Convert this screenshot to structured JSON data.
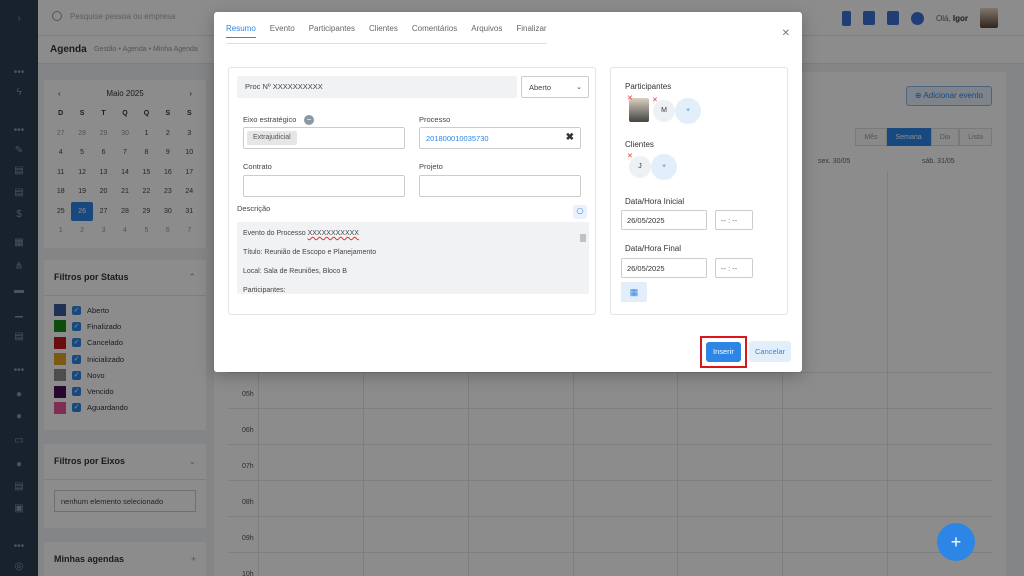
{
  "topbar": {
    "search_placeholder": "Pesquise pessoa ou empresa",
    "greeting_prefix": "Olá,",
    "user_name": "Igor"
  },
  "breadcrumb": {
    "title": "Agenda",
    "path": "Gestão • Agenda • Minha Agenda"
  },
  "calendar": {
    "month_label": "Maio 2025",
    "prev": "‹",
    "next": "›",
    "weekdays": [
      "D",
      "S",
      "T",
      "Q",
      "Q",
      "S",
      "S"
    ],
    "weeks": [
      [
        "27",
        "28",
        "29",
        "30",
        "1",
        "2",
        "3"
      ],
      [
        "4",
        "5",
        "6",
        "7",
        "8",
        "9",
        "10"
      ],
      [
        "11",
        "12",
        "13",
        "14",
        "15",
        "16",
        "17"
      ],
      [
        "18",
        "19",
        "20",
        "21",
        "22",
        "23",
        "24"
      ],
      [
        "25",
        "26",
        "27",
        "28",
        "29",
        "30",
        "31"
      ],
      [
        "1",
        "2",
        "3",
        "4",
        "5",
        "6",
        "7"
      ]
    ],
    "selected": "26"
  },
  "status_filters": {
    "title": "Filtros por Status",
    "items": [
      {
        "label": "Aberto",
        "color": "#3d5a99"
      },
      {
        "label": "Finalizado",
        "color": "#1a8a1a"
      },
      {
        "label": "Cancelado",
        "color": "#c0181e"
      },
      {
        "label": "Inicializado",
        "color": "#e0a22a"
      },
      {
        "label": "Novo",
        "color": "#8c8c8c"
      },
      {
        "label": "Vencido",
        "color": "#4a0d55"
      },
      {
        "label": "Aguardando",
        "color": "#e8549a"
      }
    ]
  },
  "eixo_filters": {
    "title": "Filtros por Eixos",
    "value": "nenhum elemento selecionado"
  },
  "my_agendas": {
    "title": "Minhas agendas",
    "add": "+"
  },
  "main": {
    "add_event_label": "Adicionar evento",
    "views": [
      "Mês",
      "Semana",
      "Dia",
      "Lista"
    ],
    "active_view": "Semana",
    "col_heads": [
      "sex. 30/05",
      "sáb. 31/05"
    ],
    "hours": [
      "05h",
      "06h",
      "07h",
      "08h",
      "09h",
      "10h"
    ]
  },
  "modal": {
    "tabs": [
      "Resumo",
      "Evento",
      "Participantes",
      "Clientes",
      "Comentários",
      "Arquivos",
      "Finalizar"
    ],
    "active_tab": "Resumo",
    "proc_title": "Proc Nº XXXXXXXXXX",
    "status_value": "Aberto",
    "eixo_label": "Eixo estratégico",
    "eixo_tag": "Extrajudicial",
    "processo_label": "Processo",
    "processo_value": "201800010035730",
    "contrato_label": "Contrato",
    "projeto_label": "Projeto",
    "descricao_label": "Descrição",
    "descricao_lines": {
      "l1_prefix": "Evento do Processo ",
      "l1_underlined": "XXXXXXXXXXX",
      "l2": "Título: Reunião de Escopo e Planejamento",
      "l3": "Local: Sala de Reuniões, Bloco B",
      "l4": "Participantes:"
    },
    "participantes_label": "Participantes",
    "participant_letter": "M",
    "clientes_label": "Clientes",
    "client_letter": "J",
    "add_symbol": "+",
    "data_inicial_label": "Data/Hora Inicial",
    "data_inicial_value": "26/05/2025",
    "data_final_label": "Data/Hora Final",
    "data_final_value": "26/05/2025",
    "time_placeholder": "-- : --",
    "insert_label": "Inserir",
    "cancel_label": "Cancelar"
  },
  "fab_label": "+"
}
